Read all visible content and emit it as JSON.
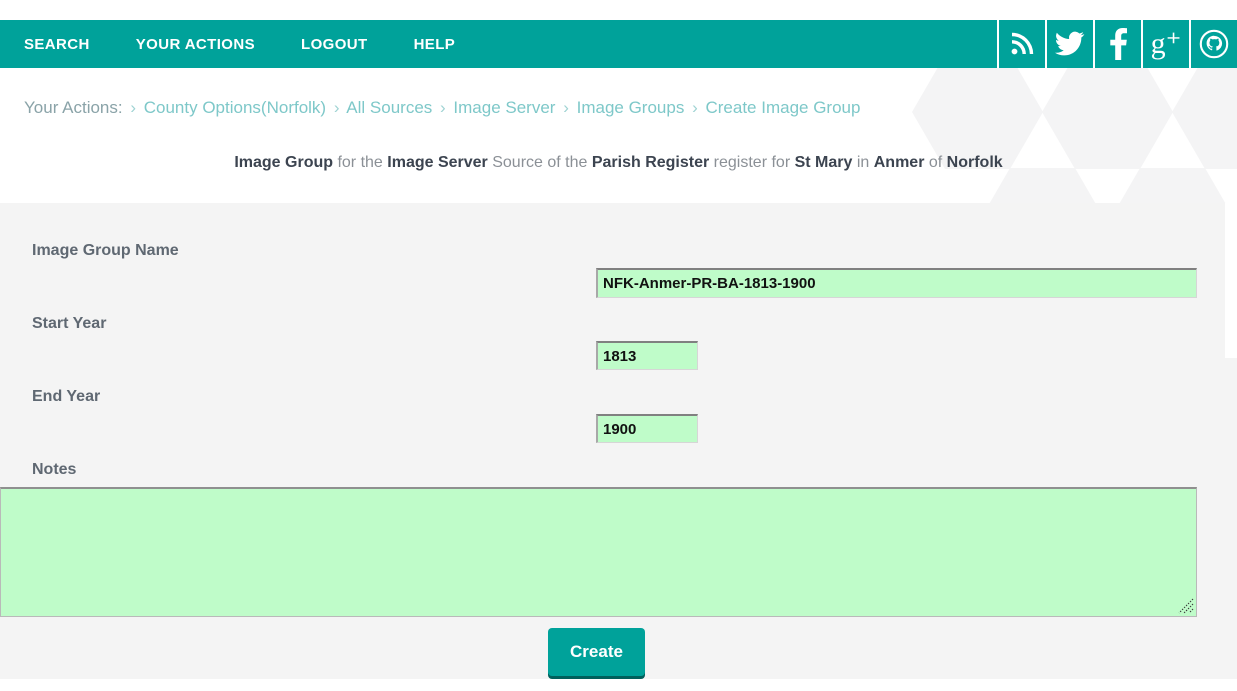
{
  "nav": {
    "links": [
      {
        "label": "SEARCH",
        "name": "nav-link-search"
      },
      {
        "label": "YOUR ACTIONS",
        "name": "nav-link-your-actions"
      },
      {
        "label": "LOGOUT",
        "name": "nav-link-logout"
      },
      {
        "label": "HELP",
        "name": "nav-link-help"
      }
    ],
    "social": [
      {
        "icon": "rss-icon",
        "label": "RSS"
      },
      {
        "icon": "twitter-icon",
        "label": "Twitter"
      },
      {
        "icon": "facebook-icon",
        "label": "Facebook"
      },
      {
        "icon": "google-plus-icon",
        "label": "Google Plus"
      },
      {
        "icon": "github-icon",
        "label": "GitHub"
      }
    ],
    "bar_color": "#00a29a"
  },
  "breadcrumb": {
    "root": "Your Actions:",
    "separator": "›",
    "items": [
      "County Options(Norfolk)",
      "All Sources",
      "Image Server",
      "Image Groups",
      "Create Image Group"
    ],
    "link_color": "#7ec8c9"
  },
  "subtitle": {
    "parts": [
      {
        "text": "Image Group",
        "bold": true
      },
      {
        "text": " for the ",
        "bold": false
      },
      {
        "text": "Image Server",
        "bold": true
      },
      {
        "text": " Source of the ",
        "bold": false
      },
      {
        "text": "Parish Register",
        "bold": true
      },
      {
        "text": " register for ",
        "bold": false
      },
      {
        "text": "St Mary",
        "bold": true
      },
      {
        "text": " in ",
        "bold": false
      },
      {
        "text": "Anmer",
        "bold": true
      },
      {
        "text": " of ",
        "bold": false
      },
      {
        "text": "Norfolk",
        "bold": true
      }
    ]
  },
  "form": {
    "field_bg_color": "#bffcc9",
    "name": {
      "label": "Image Group Name",
      "value": "NFK-Anmer-PR-BA-1813-1900",
      "placeholder": ""
    },
    "start_year": {
      "label": "Start Year",
      "value": "1813",
      "placeholder": ""
    },
    "end_year": {
      "label": "End Year",
      "value": "1900",
      "placeholder": ""
    },
    "notes": {
      "label": "Notes",
      "value": "",
      "placeholder": ""
    },
    "submit": {
      "label": "Create",
      "color": "#00a29a"
    }
  }
}
